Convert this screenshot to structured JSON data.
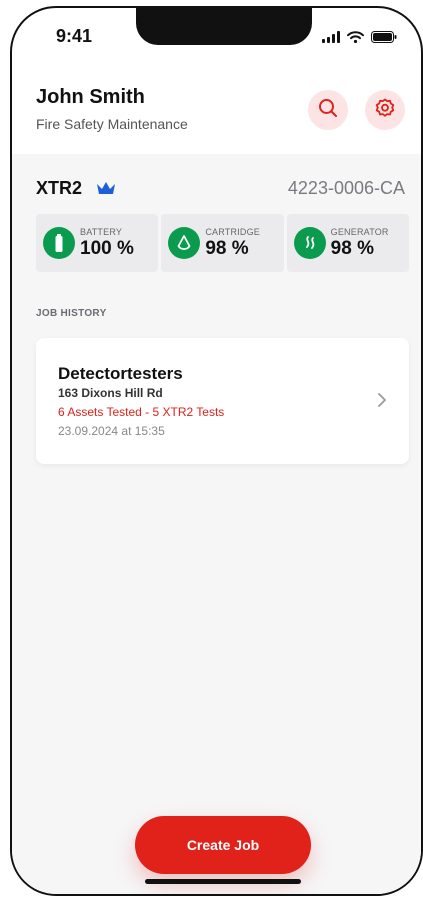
{
  "status_bar": {
    "time": "9:41"
  },
  "header": {
    "name": "John Smith",
    "role": "Fire Safety Maintenance"
  },
  "device": {
    "model": "XTR2",
    "serial": "4223-0006-CA"
  },
  "stats": [
    {
      "label": "BATTERY",
      "value": "100 %",
      "icon": "battery-icon",
      "color": "#0a9b4e"
    },
    {
      "label": "CARTRIDGE",
      "value": "98 %",
      "icon": "drop-icon",
      "color": "#0a9b4e"
    },
    {
      "label": "GENERATOR",
      "value": "98 %",
      "icon": "heat-icon",
      "color": "#0a9b4e"
    }
  ],
  "job_history": {
    "title": "JOB HISTORY",
    "jobs": [
      {
        "name": "Detectortesters",
        "address": "163 Dixons Hill Rd",
        "summary": "6 Assets Tested - 5 XTR2 Tests",
        "date": "23.09.2024 at 15:35"
      }
    ]
  },
  "actions": {
    "create_job": "Create Job"
  },
  "colors": {
    "accent": "#e0221b",
    "accent_soft": "#fde4e4",
    "success": "#0a9b4e",
    "crown": "#1d5fd6"
  }
}
